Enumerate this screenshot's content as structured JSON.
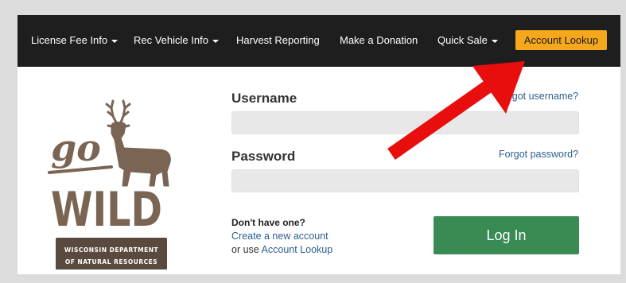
{
  "nav": {
    "items": [
      {
        "label": "License Fee Info",
        "has_dropdown": true
      },
      {
        "label": "Rec Vehicle Info",
        "has_dropdown": true
      },
      {
        "label": "Harvest Reporting",
        "has_dropdown": false
      },
      {
        "label": "Make a Donation",
        "has_dropdown": false
      },
      {
        "label": "Quick Sale",
        "has_dropdown": true
      }
    ],
    "cta_label": "Account Lookup"
  },
  "logo": {
    "go": "go",
    "wild": "WILD",
    "org_line1": "WISCONSIN DEPARTMENT",
    "org_line2": "OF NATURAL RESOURCES"
  },
  "login": {
    "username_label": "Username",
    "username_value": "",
    "forgot_username": "Forgot username?",
    "password_label": "Password",
    "password_value": "",
    "forgot_password": "Forgot password?",
    "signup_prompt": "Don't have one?",
    "create_account": "Create a new account",
    "or_use": "or use",
    "account_lookup": "Account Lookup",
    "submit_label": "Log In"
  },
  "colors": {
    "navbar": "#1e1e1e",
    "cta": "#f5a81c",
    "submit": "#3a8a54",
    "link": "#2c5f8e",
    "arrow": "#e80e0e",
    "logo_brown": "#7a6554"
  }
}
